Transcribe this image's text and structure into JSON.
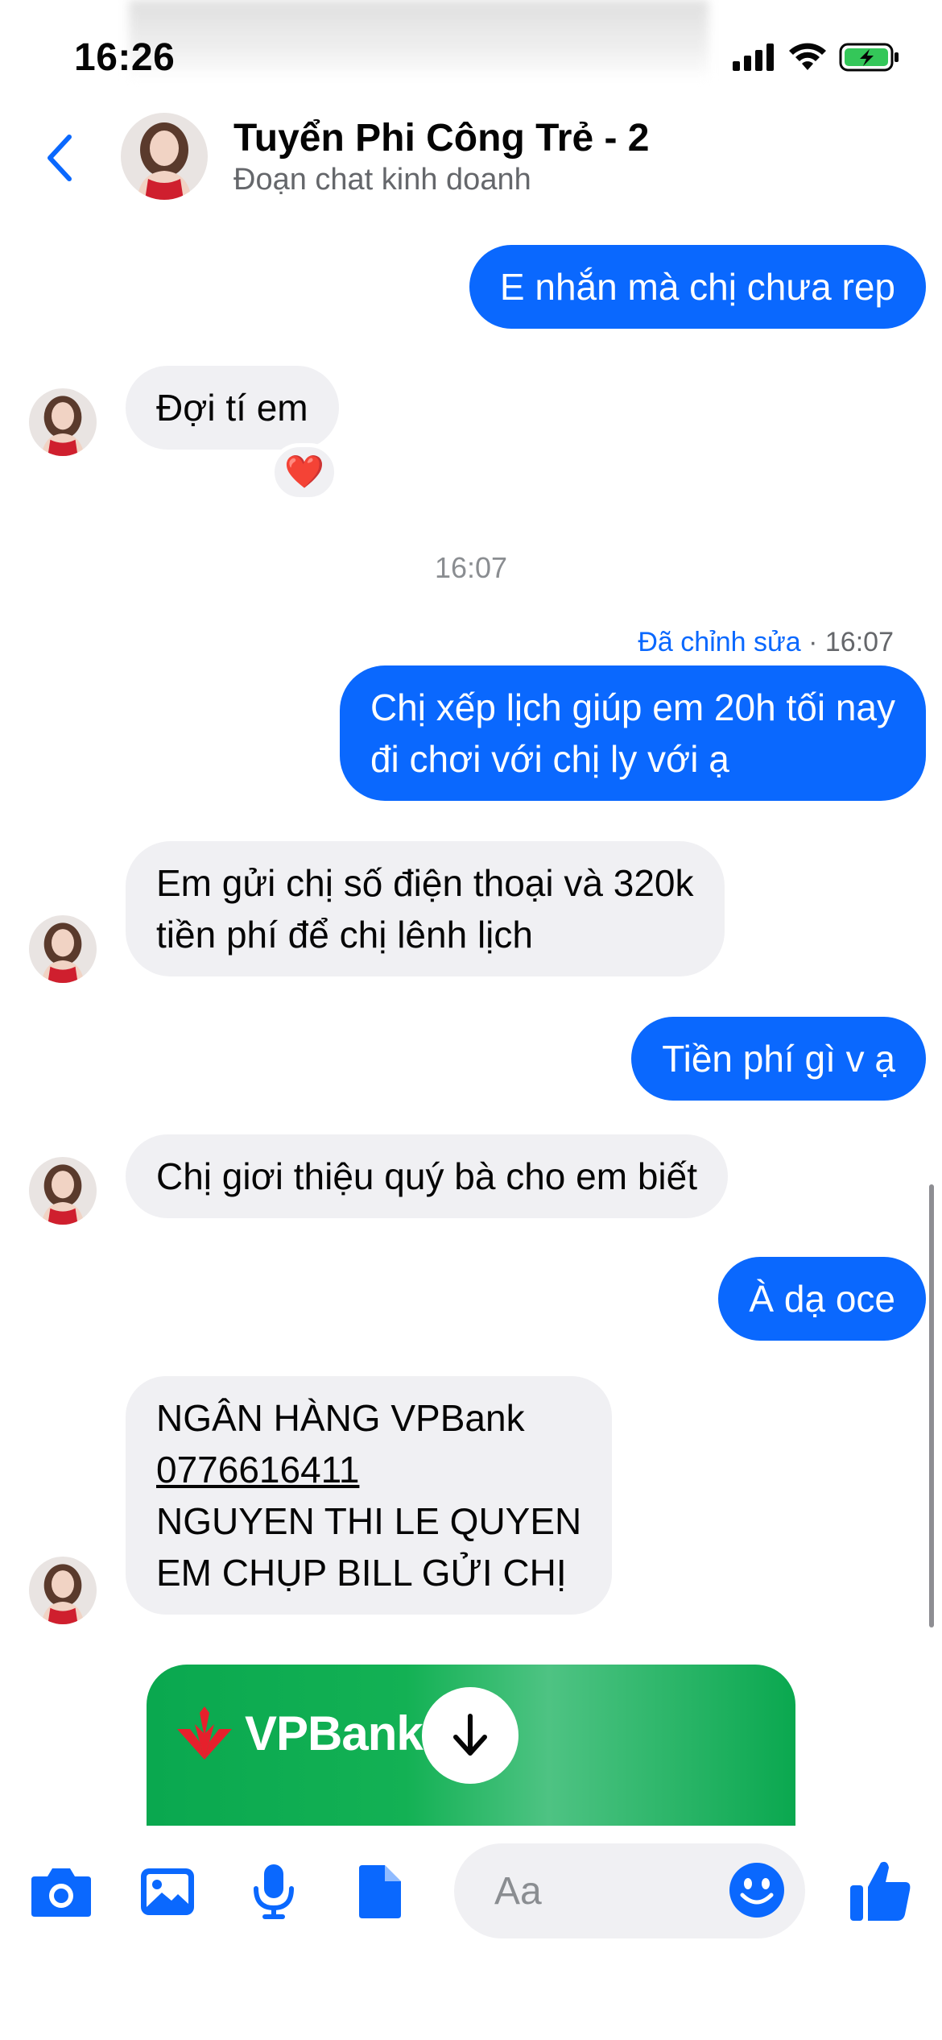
{
  "status_bar": {
    "time": "16:26",
    "battery_label": "battery-charging"
  },
  "header": {
    "back_icon": "chevron-left-icon",
    "title": "Tuyển Phi Công Trẻ - 2",
    "subtitle": "Đoạn chat kinh doanh"
  },
  "messages": {
    "m1": "E nhắn mà chị chưa rep",
    "m2": "Đợi tí em",
    "m2_reaction": "❤️",
    "time_separator": "16:07",
    "edited_label": "Đã chỉnh sửa",
    "edited_time": " · 16:07",
    "m3_line1": "Chị xếp lịch giúp em 20h tối nay",
    "m3_line2": "đi chơi với chị ly với ạ",
    "m4_line1": "Em gửi chị số điện thoại và 320k",
    "m4_line2": "tiền phí để chị lênh lịch",
    "m5": "Tiền phí gì v ạ",
    "m6": "Chị giơi thiệu quý bà cho em biết",
    "m7": "À dạ oce",
    "m8_line1": "NGÂN HÀNG VPBank",
    "m8_line2": "0776616411",
    "m8_line3": "NGUYEN THI LE QUYEN",
    "m8_line4": "EM CHỤP BILL GỬI CHỊ"
  },
  "attachment": {
    "brand": "VPBank",
    "action_icon": "download-arrow-icon"
  },
  "composer": {
    "placeholder": "Aa",
    "tools": [
      "camera-icon",
      "image-icon",
      "microphone-icon",
      "file-icon"
    ],
    "emoji_icon": "emoji-icon",
    "like_icon": "thumbs-up-icon"
  },
  "colors": {
    "accent": "#0a68fe",
    "incoming_bubble": "#f0f0f3",
    "bank_green": "#0aa84f"
  }
}
